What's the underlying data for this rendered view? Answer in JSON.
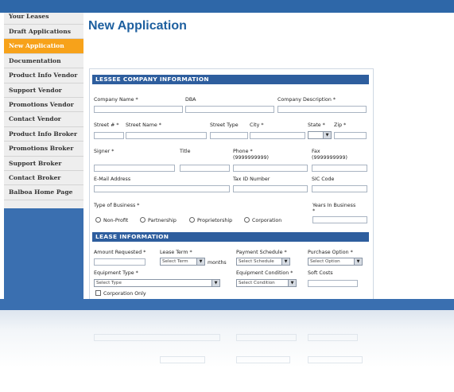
{
  "sidebar": {
    "items": [
      {
        "label": "Your Leases"
      },
      {
        "label": "Draft Applications"
      },
      {
        "label": "New Application"
      },
      {
        "label": "Documentation"
      },
      {
        "label": "Product Info Vendor"
      },
      {
        "label": "Support Vendor"
      },
      {
        "label": "Promotions Vendor"
      },
      {
        "label": "Contact Vendor"
      },
      {
        "label": "Product Info Broker"
      },
      {
        "label": "Promotions Broker"
      },
      {
        "label": "Support Broker"
      },
      {
        "label": "Contact Broker"
      },
      {
        "label": "Balboa Home Page"
      }
    ],
    "active_index": 2
  },
  "page": {
    "title": "New Application"
  },
  "lessee": {
    "heading": "LESSEE COMPANY INFORMATION",
    "company_name": "Company Name *",
    "dba": "DBA",
    "company_description": "Company Description *",
    "street_num": "Street # *",
    "street_name": "Street Name *",
    "street_type": "Street Type",
    "city": "City *",
    "state": "State *",
    "zip": "Zip *",
    "signer": "Signer *",
    "title": "Title",
    "phone": "Phone *",
    "phone_format": "(9999999999)",
    "fax": "Fax",
    "fax_format": "(9999999999)",
    "email": "E-Mail Address",
    "tax_id": "Tax ID Number",
    "sic": "SIC Code",
    "type_of_business": "Type of Business *",
    "years_in_business": "Years In Business",
    "years_star": "*",
    "business_types": [
      "Non-Profit",
      "Partnership",
      "Proprietorship",
      "Corporation"
    ]
  },
  "lease": {
    "heading": "LEASE INFORMATION",
    "amount_requested": "Amount Requested *",
    "lease_term": "Lease Term *",
    "lease_term_select": "Select Term",
    "months": "months",
    "payment_schedule": "Payment Schedule *",
    "payment_schedule_select": "Select Schedule",
    "purchase_option": "Purchase Option *",
    "purchase_option_select": "Select Option",
    "equipment_type": "Equipment Type *",
    "equipment_type_select": "Select Type",
    "equipment_condition": "Equipment Condition *",
    "equipment_condition_select": "Select Condition",
    "soft_costs": "Soft Costs",
    "corporation_only": "Corporation Only"
  },
  "icons": {
    "dropdown": "chevron-down-icon"
  },
  "colors": {
    "header_blue": "#2e5e9e",
    "title_blue": "#1d5f9f",
    "active_orange": "#f7a21a",
    "bar_blue": "#3a6fb0"
  }
}
